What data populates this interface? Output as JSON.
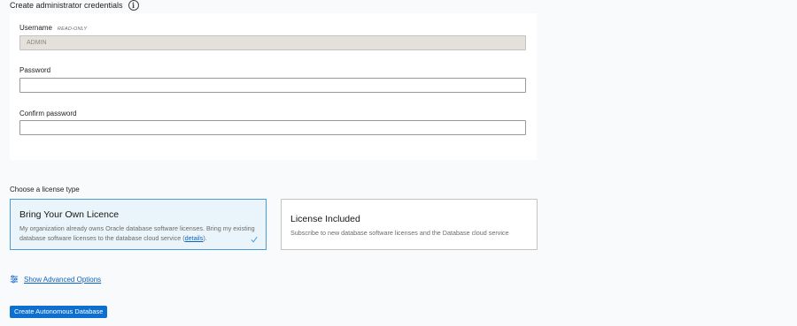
{
  "credentials": {
    "heading": "Create administrator credentials",
    "info_icon": "info-icon",
    "username_label": "Username",
    "username_tag": "READ-ONLY",
    "username_value": "ADMIN",
    "password_label": "Password",
    "password_value": "",
    "confirm_label": "Confirm password",
    "confirm_value": ""
  },
  "license": {
    "heading": "Choose a license type",
    "options": [
      {
        "title": "Bring Your Own Licence",
        "desc_before": "My organization already owns Oracle database software licenses. Bring my existing database software licenses to the database cloud service (",
        "link": "details",
        "desc_after": ").",
        "selected": true
      },
      {
        "title": "License Included",
        "description": "Subscribe to new database software licenses and the Database cloud service",
        "selected": false
      }
    ]
  },
  "advanced": {
    "label": "Show Advanced Options",
    "icon": "sliders-icon"
  },
  "submit": {
    "label": "Create Autonomous Database"
  },
  "colors": {
    "primary": "#0d6fcf",
    "link": "#0c62c4",
    "selected_card_bg": "#eaf4fb",
    "selected_card_border": "#4c9bd6"
  }
}
